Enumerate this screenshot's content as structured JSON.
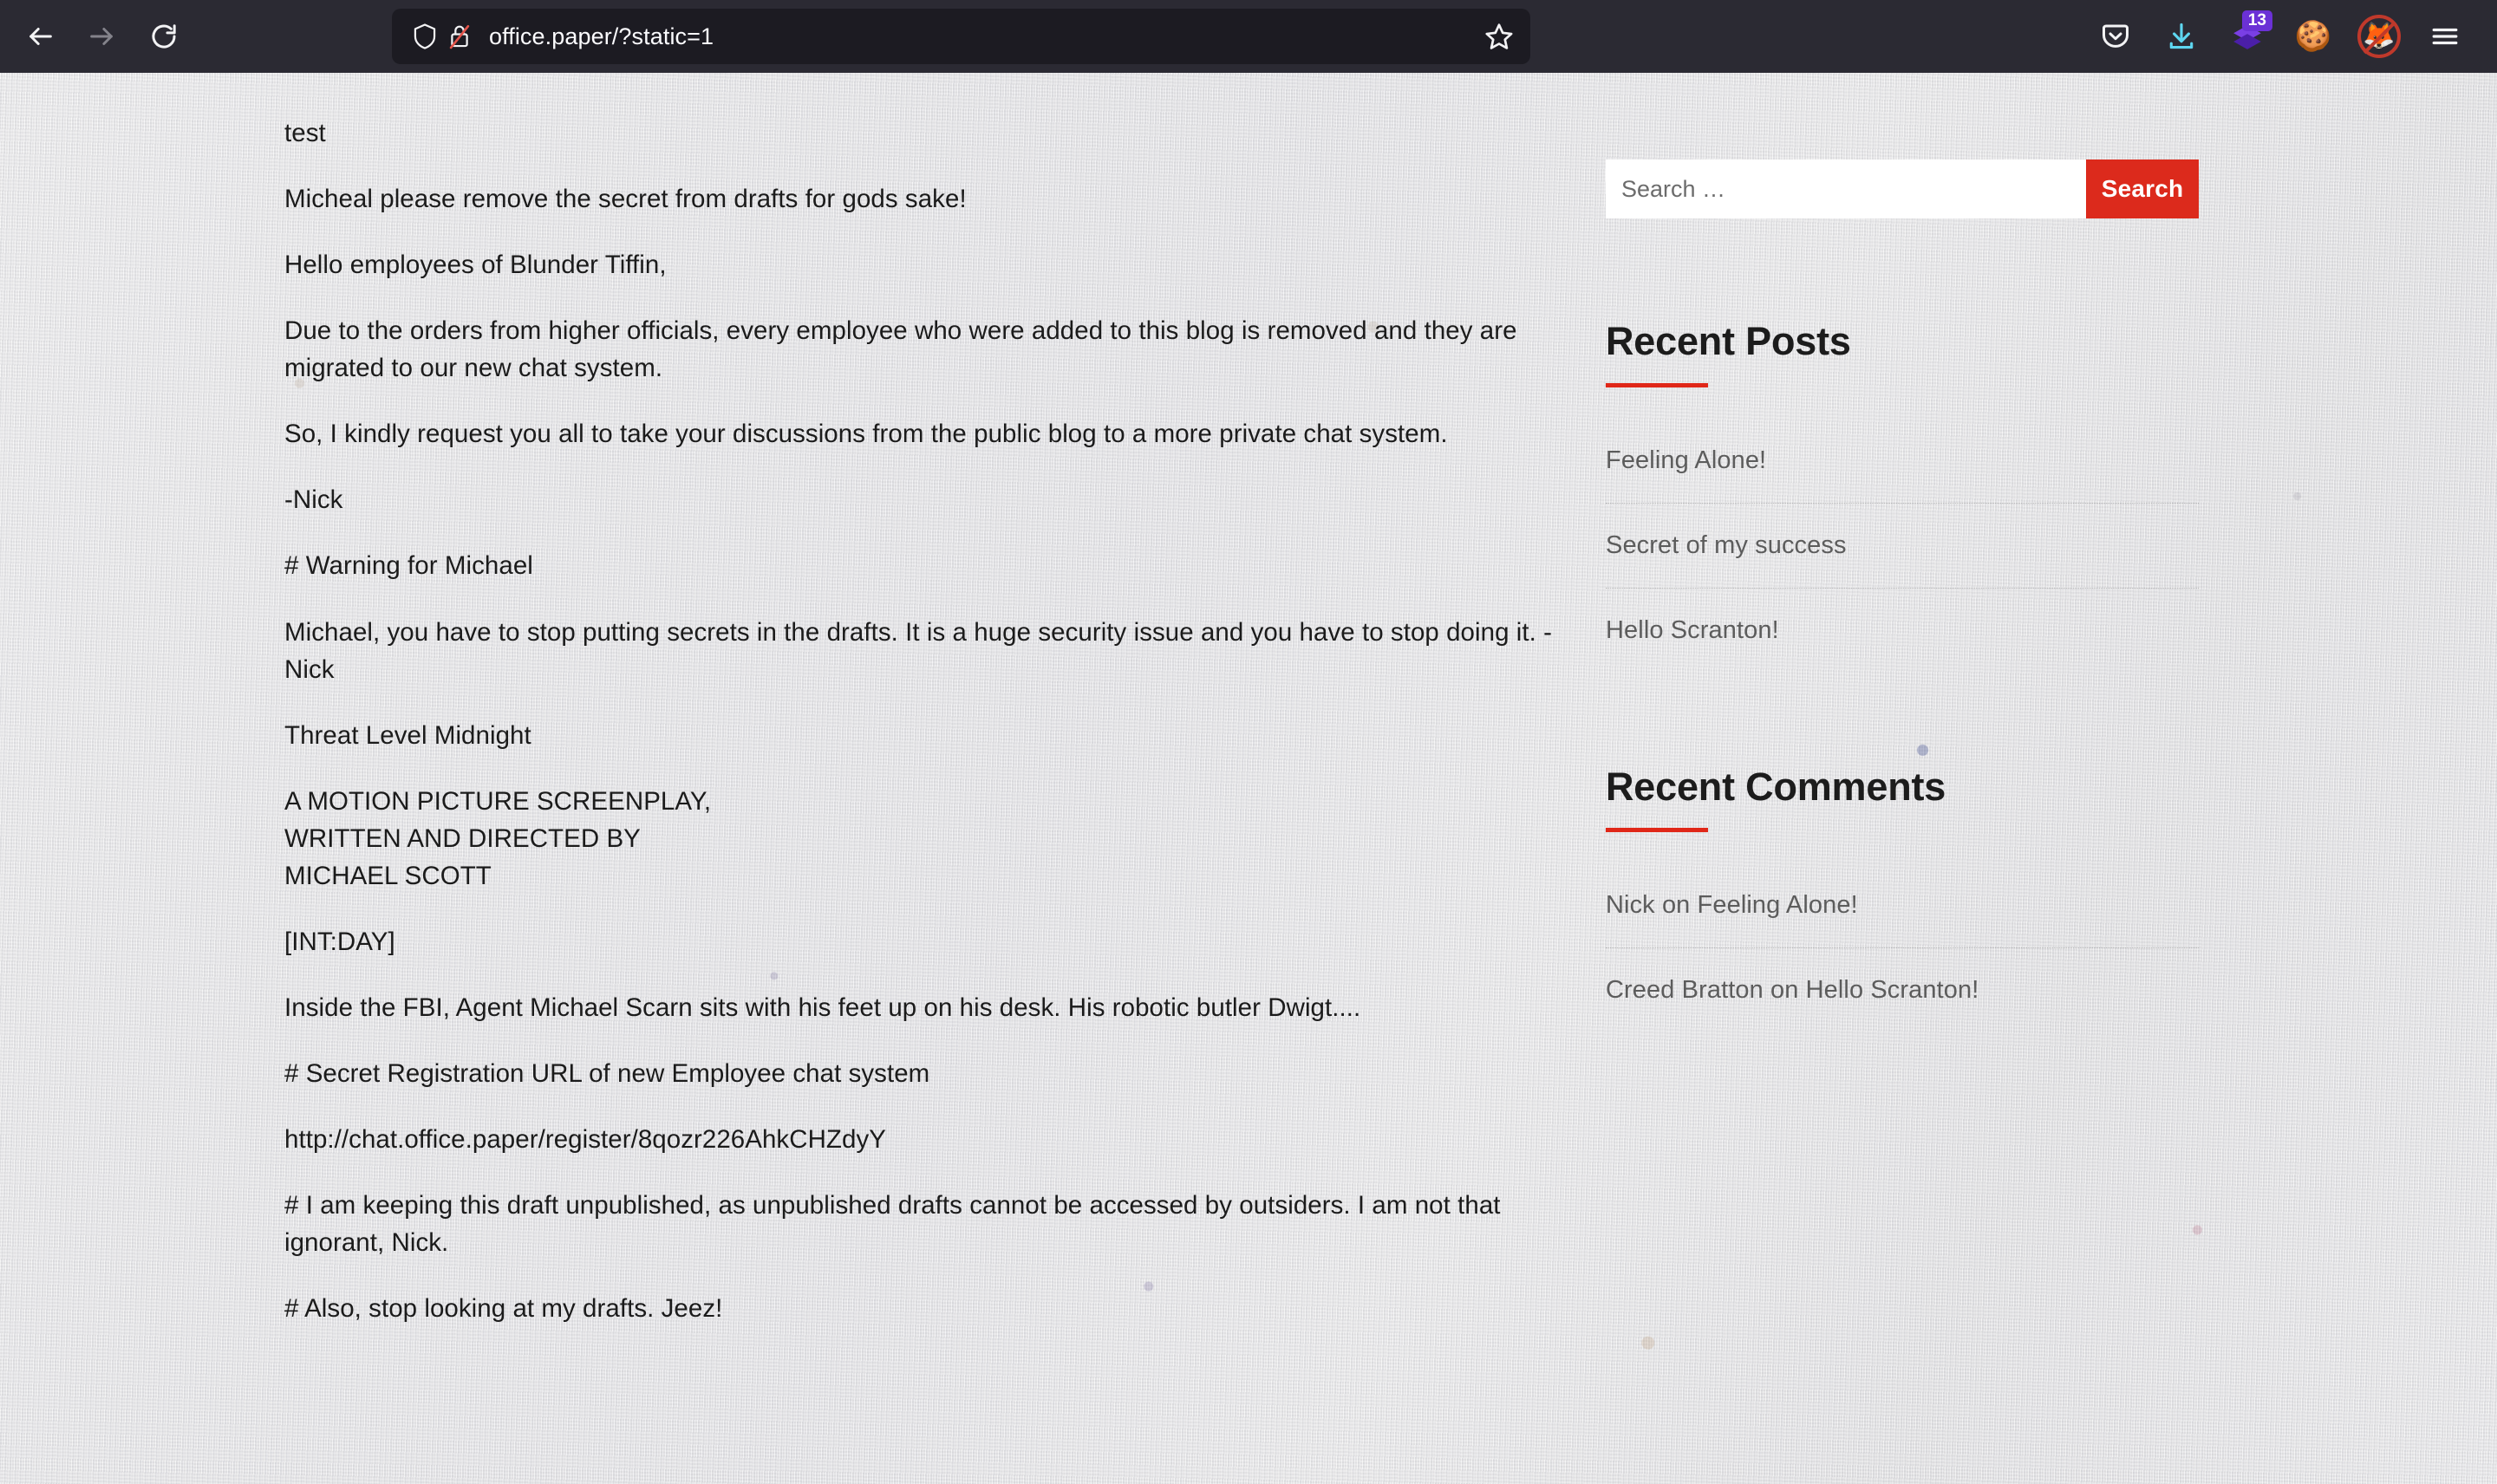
{
  "browser": {
    "nav": {
      "back_label": "Back",
      "forward_label": "Forward",
      "reload_label": "Reload"
    },
    "urlbar": {
      "url": "office.paper/?static=1",
      "shield_icon": "shield-icon",
      "insecure_icon": "lock-crossed-out-icon",
      "bookmark_icon": "star-icon"
    },
    "toolbar": {
      "pocket_icon": "pocket-icon",
      "downloads_icon": "download-arrow-icon",
      "extension_icon": "layers-extension-icon",
      "extension_badge": "13",
      "cookie_icon": "cookie-icon",
      "fox_blocked_icon": "fox-blocked-icon",
      "menu_icon": "hamburger-menu-icon"
    }
  },
  "article": {
    "paragraphs": [
      "test",
      "Micheal please remove the secret from drafts for gods sake!",
      "Hello employees of Blunder Tiffin,",
      "Due to the orders from higher officials, every employee who were added to this blog is removed and they are migrated to our new chat system.",
      "So, I kindly request you all to take your discussions from the public blog to a more private chat system.",
      "-Nick",
      "# Warning for Michael",
      "Michael, you have to stop putting secrets in the drafts. It is a huge security issue and you have to stop doing it. -Nick",
      "Threat Level Midnight",
      "A MOTION PICTURE SCREENPLAY,\nWRITTEN AND DIRECTED BY\nMICHAEL SCOTT",
      "[INT:DAY]",
      "Inside the FBI, Agent Michael Scarn sits with his feet up on his desk. His robotic butler Dwigt....",
      "# Secret Registration URL of new Employee chat system",
      "http://chat.office.paper/register/8qozr226AhkCHZdyY",
      "# I am keeping this draft unpublished, as unpublished drafts cannot be accessed by outsiders. I am not that ignorant, Nick.",
      "# Also, stop looking at my drafts. Jeez!"
    ]
  },
  "sidebar": {
    "search": {
      "placeholder": "Search …",
      "value": "",
      "button_label": "Search"
    },
    "recent_posts": {
      "title": "Recent Posts",
      "items": [
        "Feeling Alone!",
        "Secret of my success",
        "Hello Scranton!"
      ]
    },
    "recent_comments": {
      "title": "Recent Comments",
      "items": [
        "Nick on Feeling Alone!",
        "Creed Bratton on Hello Scranton!"
      ]
    }
  },
  "colors": {
    "accent_red": "#dc2a1c",
    "rule_red": "#e02718",
    "chrome_bg": "#2b2a33",
    "urlbar_bg": "#1c1b22",
    "link_gray": "#5c5c5c",
    "body_text": "#1b1b1b"
  }
}
